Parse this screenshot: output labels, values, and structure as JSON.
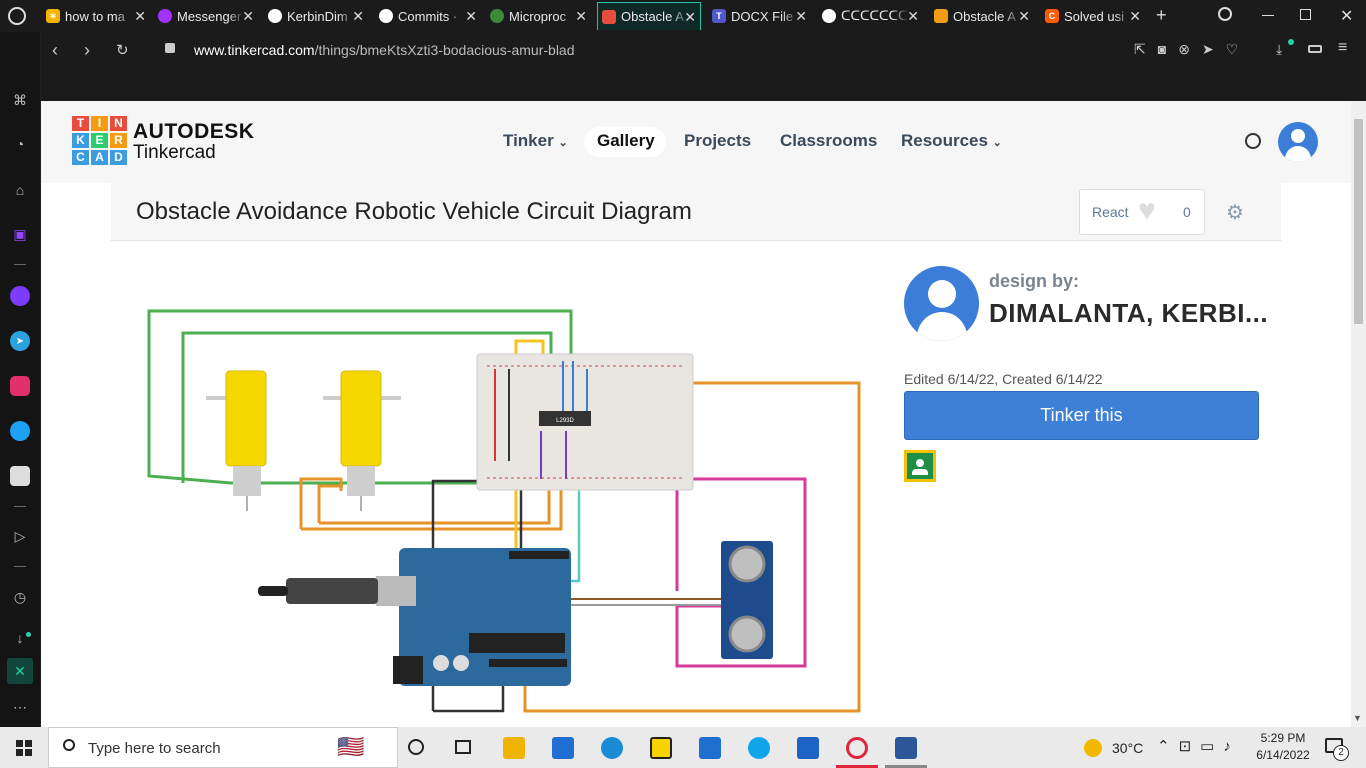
{
  "browser": {
    "tabs": [
      {
        "title": "how to ma",
        "color": "#f4b400"
      },
      {
        "title": "Messenger",
        "color": "#a033ff"
      },
      {
        "title": "KerbinDim",
        "color": "#ffffff"
      },
      {
        "title": "Commits ·",
        "color": "#ffffff"
      },
      {
        "title": "Microproc",
        "color": "#3a8a3a"
      },
      {
        "title": "Obstacle A",
        "color": "#e74c3c"
      },
      {
        "title": "DOCX File",
        "color": "#5059c9"
      },
      {
        "title": "ᑕᑕᑕᑕᑕᑕᑕD",
        "color": "#ffffff"
      },
      {
        "title": "Obstacle A",
        "color": "#f39c12"
      },
      {
        "title": "Solved usi",
        "color": "#ff5a00"
      }
    ],
    "url_host": "www.tinkercad.com",
    "url_path": "/things/bmeKtsXzti3-bodacious-amur-blad"
  },
  "tinkercad": {
    "logo_letters": [
      "T",
      "I",
      "N",
      "K",
      "E",
      "R",
      "C",
      "A",
      "D"
    ],
    "brand_top": "AUTODESK",
    "brand_bottom": "Tinkercad",
    "nav": [
      "Tinker",
      "Gallery",
      "Projects",
      "Classrooms",
      "Resources"
    ],
    "title": "Obstacle Avoidance Robotic Vehicle Circuit Diagram",
    "react_label": "React",
    "react_count": "0",
    "design_by_label": "design by:",
    "author": "DIMALANTA, KERBI...",
    "dates": "Edited 6/14/22, Created 6/14/22",
    "tinker_button": "Tinker this",
    "chip_label": "L293D"
  },
  "taskbar": {
    "search_placeholder": "Type here to search",
    "weather": "30°C",
    "time": "5:29 PM",
    "date": "6/14/2022",
    "notifications": "2"
  }
}
